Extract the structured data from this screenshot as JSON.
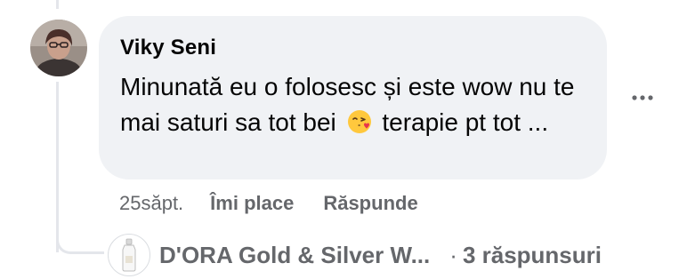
{
  "comment": {
    "author": "Viky Seni",
    "text_part1": "Minunată eu o folosesc și este wow nu te mai saturi sa tot bei",
    "emoji": "face-blowing-kiss",
    "text_part2": "terapie pt tot ..."
  },
  "actions": {
    "time": "25săpt.",
    "like_label": "Îmi place",
    "reply_label": "Răspunde"
  },
  "replies": {
    "replier_name": "D'ORA Gold & Silver W...",
    "separator": "·",
    "count_label": "3 răspunsuri"
  },
  "icons": {
    "more": "more-options-icon",
    "avatar": "user-avatar",
    "replier_avatar": "brand-bottle-logo"
  },
  "colors": {
    "bubble": "#f0f2f5",
    "primary_text": "#050505",
    "secondary_text": "#65676b",
    "thread_line": "#e4e6eb"
  }
}
